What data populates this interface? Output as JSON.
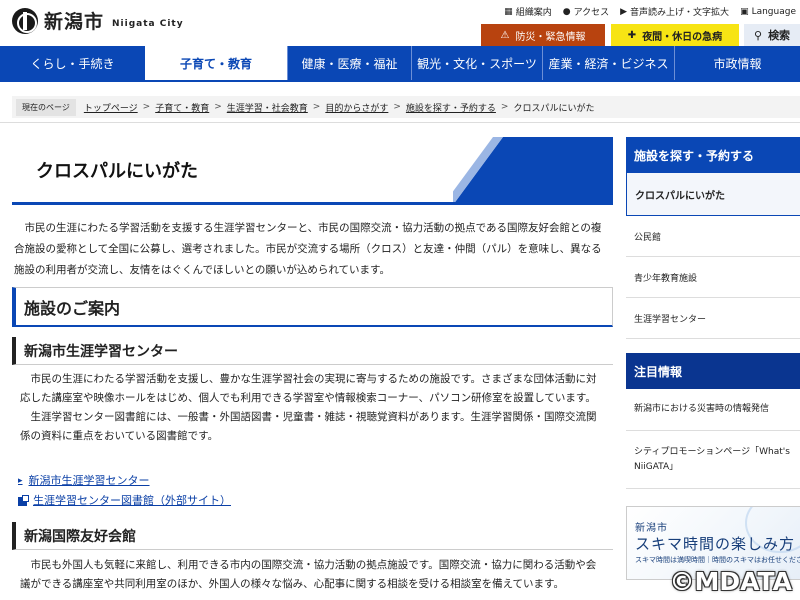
{
  "header": {
    "logo_jp": "新潟市",
    "logo_en": "Niigata City",
    "util": [
      {
        "icon": "sitemap-icon",
        "label": "組織案内"
      },
      {
        "icon": "location-pin-icon",
        "label": "アクセス"
      },
      {
        "icon": "speaker-icon",
        "label": "音声読み上げ・文字拡大"
      },
      {
        "icon": "translate-icon",
        "label": "Language"
      }
    ],
    "emergency": "防災・緊急情報",
    "night": "夜間・休日の急病",
    "search": "検索"
  },
  "nav": {
    "items": [
      "くらし・手続き",
      "子育て・教育",
      "健康・医療・福祉",
      "観光・文化・スポーツ",
      "産業・経済・ビジネス",
      "市政情報"
    ],
    "active_index": 1
  },
  "breadcrumb": {
    "here_label": "現在のページ",
    "items": [
      "トップページ",
      "子育て・教育",
      "生涯学習・社会教育",
      "目的からさがす",
      "施設を探す・予約する",
      "クロスパルにいがた"
    ]
  },
  "page": {
    "title": "クロスパルにいがた",
    "intro": "市民の生涯にわたる学習活動を支援する生涯学習センターと、市民の国際交流・協力活動の拠点である国際友好会館との複合施設の愛称として全国に公募し、選考されました。市民が交流する場所（クロス）と友達・仲間（パル）を意味し、異なる施設の利用者が交流し、友情をはぐくんでほしいとの願いが込められています。",
    "h2": "施設のご案内",
    "section1": {
      "heading": "新潟市生涯学習センター",
      "p1": "市民の生涯にわたる学習活動を支援し、豊かな生涯学習社会の実現に寄与するための施設です。さまざまな団体活動に対応した講座室や映像ホールをはじめ、個人でも利用できる学習室や情報検索コーナー、パソコン研修室を設置しています。",
      "p2": "生涯学習センター図書館には、一般書・外国語図書・児童書・雑誌・視聴覚資料があります。生涯学習関係・国際交流関係の資料に重点をおいている図書館です。",
      "link1": "新潟市生涯学習センター",
      "link2": "生涯学習センター図書館（外部サイト）"
    },
    "section2": {
      "heading": "新潟国際友好会館",
      "p1": "市民も外国人も気軽に来館し、利用できる市内の国際交流・協力活動の拠点施設です。国際交流・協力に関わる活動や会議ができる講座室や共同利用室のほか、外国人の様々な悩み、心配事に関する相談を受ける相談室を備えています。"
    }
  },
  "sidebar": {
    "heading": "施設を探す・予約する",
    "active": "クロスパルにいがた",
    "items": [
      "公民館",
      "青少年教育施設",
      "生涯学習センター"
    ],
    "heading2": "注目情報",
    "news": [
      "新潟市における災害時の情報発信",
      "シティプロモーションページ「What's NiiGATA」"
    ]
  },
  "banner": {
    "line1": "新潟市",
    "line2": "スキマ時間の楽しみ方",
    "line3": "スキマ時間は満喫時間｜時間のスキマはお任せください"
  },
  "watermark": "©MDATA",
  "colors": {
    "brand_blue": "#0a47b5",
    "emergency": "#b8430f",
    "night": "#f7e414"
  }
}
